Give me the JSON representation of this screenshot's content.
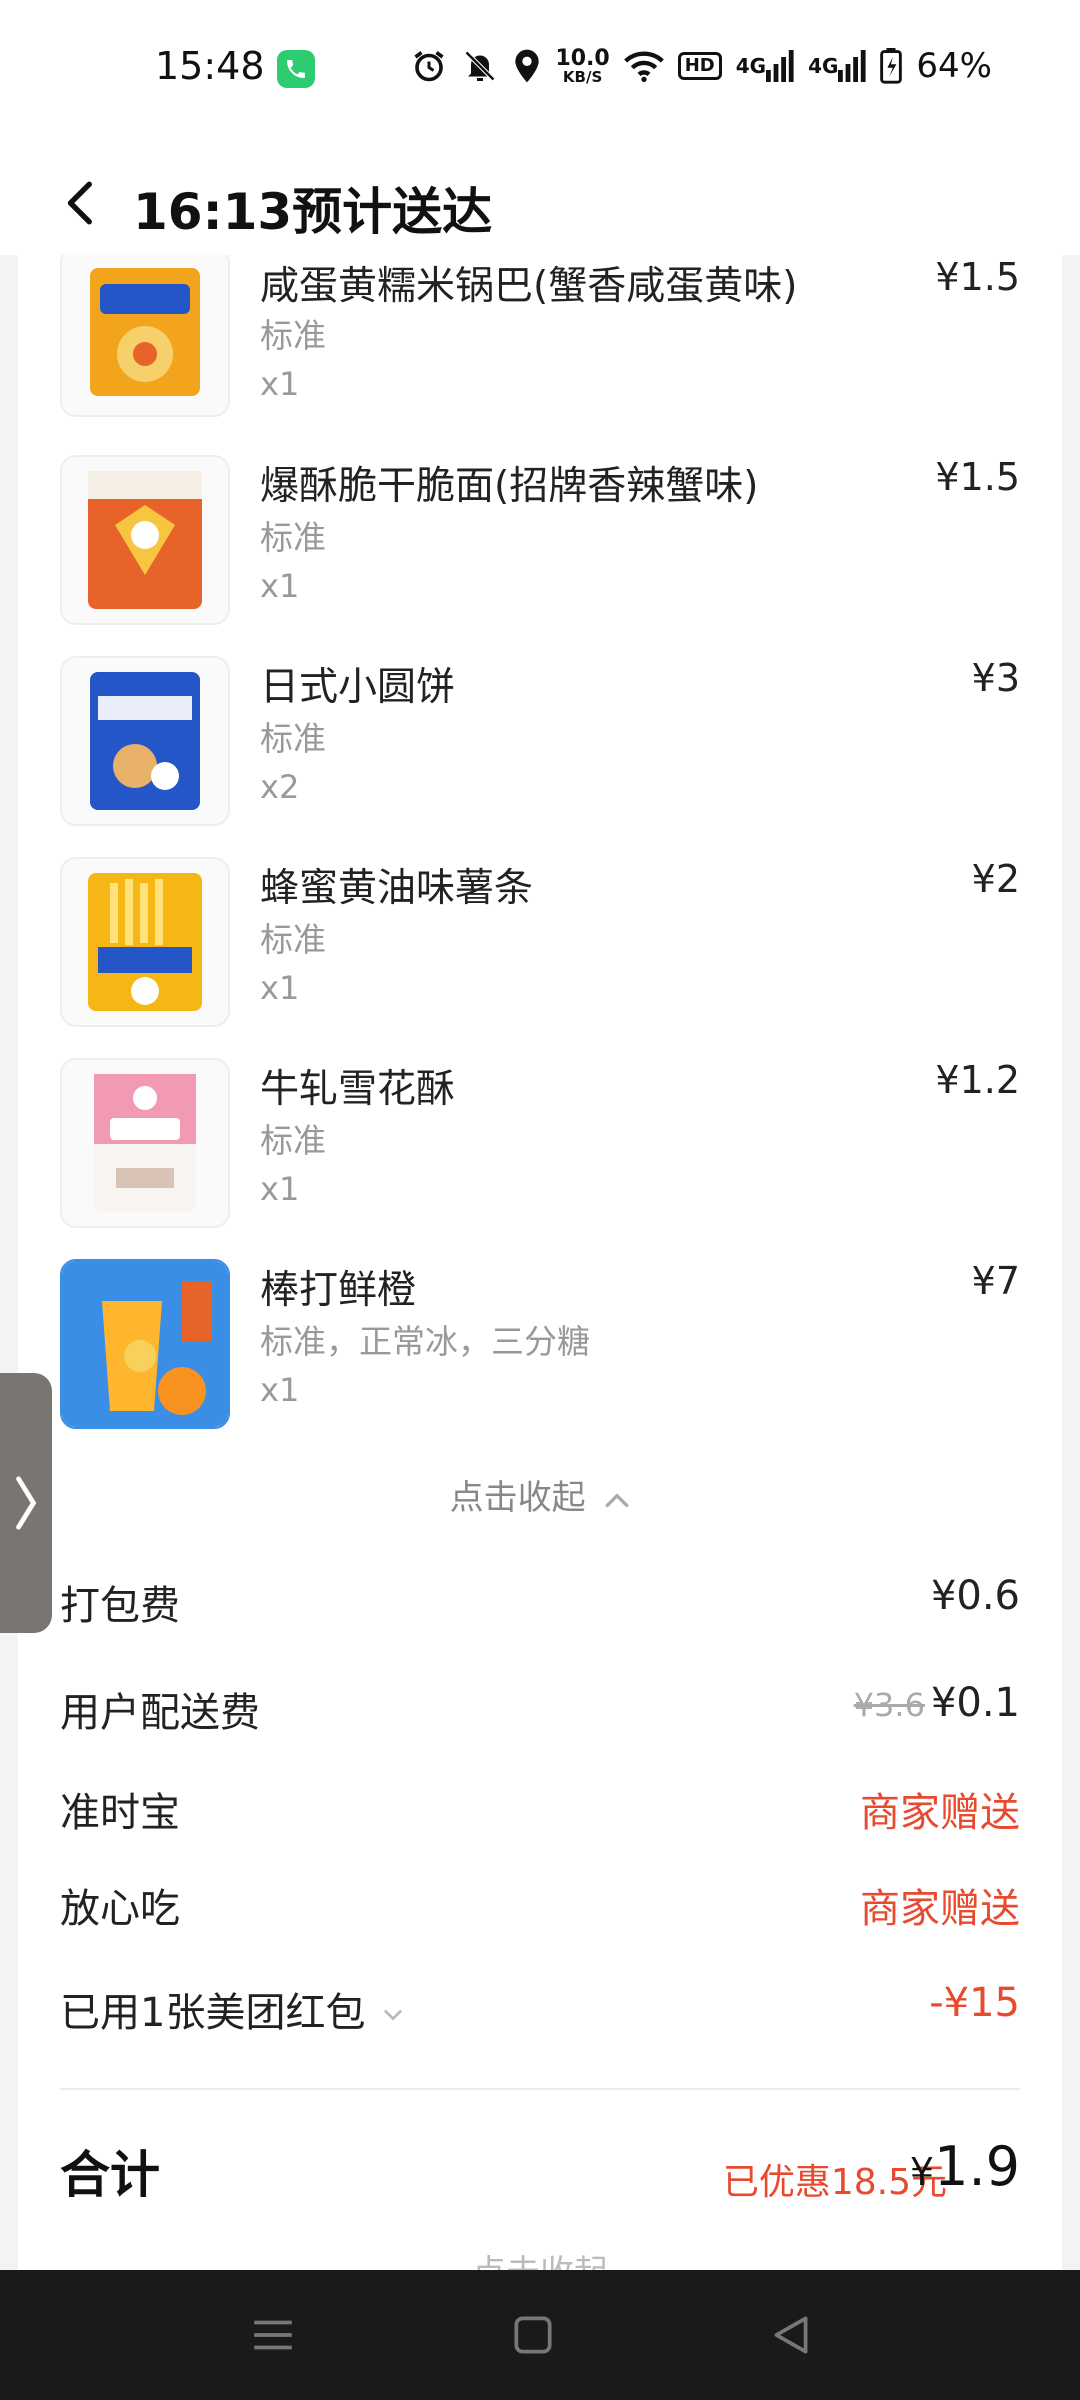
{
  "status_bar": {
    "time": "15:48",
    "net_speed_value": "10.0",
    "net_speed_unit": "KB/S",
    "hd_label": "HD",
    "sig1": "4G",
    "sig2": "4G",
    "battery": "64%"
  },
  "header": {
    "title": "16:13预计送达"
  },
  "items": [
    {
      "name": "咸蛋黄糯米锅巴(蟹香咸蛋黄味)",
      "spec": "标准",
      "qty": "x1",
      "price": "¥1.5",
      "thumb_color": "#f2a51c"
    },
    {
      "name": "爆酥脆干脆面(招牌香辣蟹味)",
      "spec": "标准",
      "qty": "x1",
      "price": "¥1.5",
      "thumb_color": "#e8632a"
    },
    {
      "name": "日式小圆饼",
      "spec": "标准",
      "qty": "x2",
      "price": "¥3",
      "thumb_color": "#2456c8"
    },
    {
      "name": "蜂蜜黄油味薯条",
      "spec": "标准",
      "qty": "x1",
      "price": "¥2",
      "thumb_color": "#f5b616"
    },
    {
      "name": "牛轧雪花酥",
      "spec": "标准",
      "qty": "x1",
      "price": "¥1.2",
      "thumb_color": "#f29ab3"
    },
    {
      "name": "棒打鲜橙",
      "spec": "标准，正常冰，三分糖",
      "qty": "x1",
      "price": "¥7",
      "thumb_color": "#3a8ee6"
    }
  ],
  "collapse_label": "点击收起",
  "fees": {
    "packing_label": "打包费",
    "packing_value": "¥0.6",
    "delivery_label": "用户配送费",
    "delivery_original": "¥3.6",
    "delivery_value": "¥0.1",
    "ontime_label": "准时宝",
    "ontime_value": "商家赠送",
    "safe_label": "放心吃",
    "safe_value": "商家赠送",
    "coupon_label": "已用1张美团红包",
    "coupon_value": "-¥15"
  },
  "total": {
    "label": "合计",
    "discount": "已优惠18.5元",
    "yen": "¥",
    "amount": "1.9"
  },
  "peek_text": "点击收起"
}
